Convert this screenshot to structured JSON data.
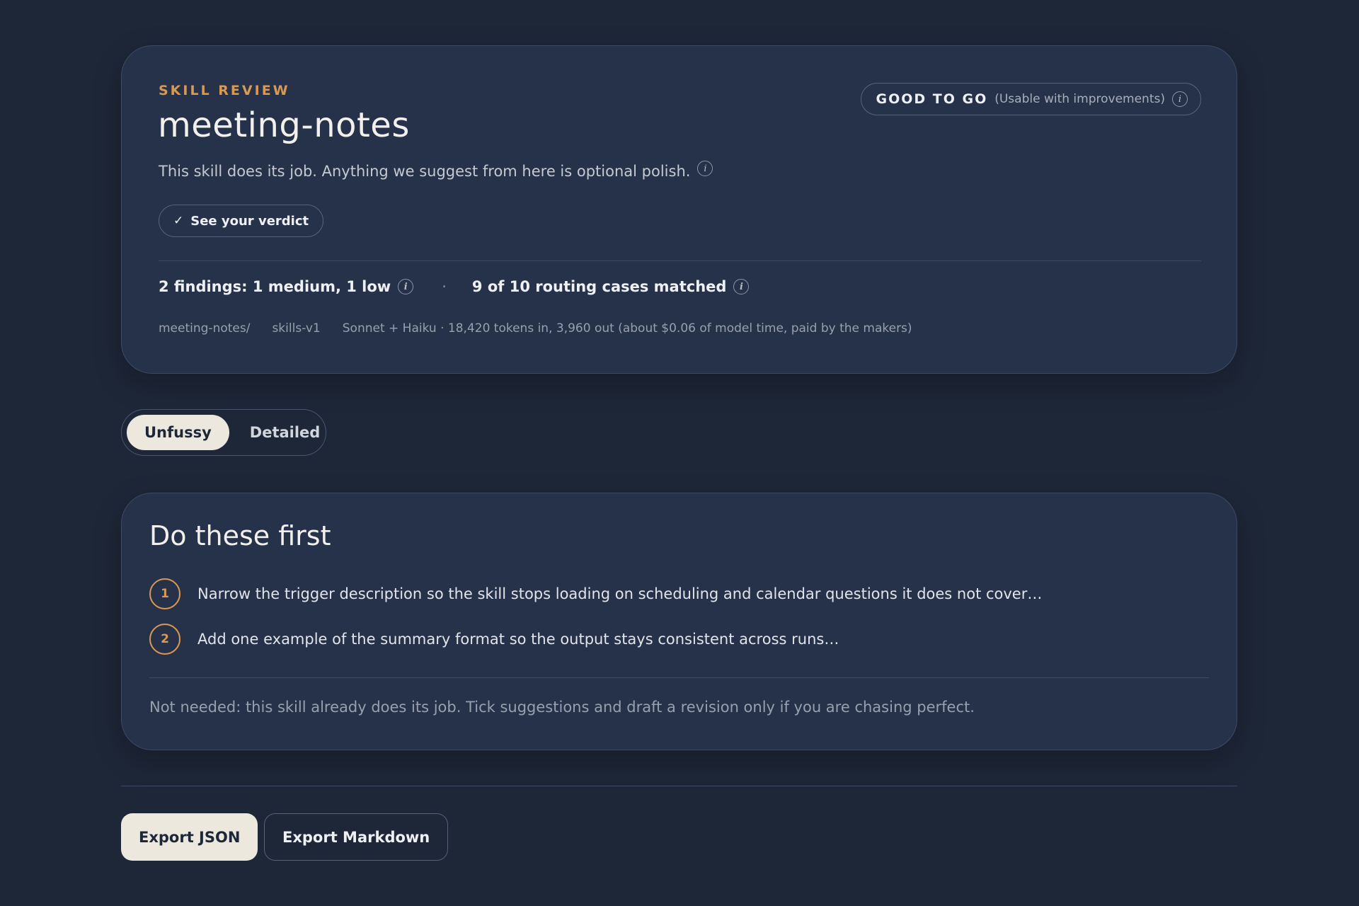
{
  "header": {
    "eyebrow": "SKILL REVIEW",
    "title": "meeting-notes",
    "subtitle": "This skill does its job. Anything we suggest from here is optional polish.",
    "status_main": "GOOD TO GO",
    "status_sub": "(Usable with improvements)",
    "verdict_label": "See your verdict",
    "findings": "2 findings: 1 medium, 1 low",
    "separator": "·",
    "routing": "9 of 10 routing cases matched",
    "meta": [
      "meeting-notes/",
      "skills-v1",
      "Sonnet + Haiku · 18,420 tokens in, 3,960 out (about $0.06 of model time, paid by the makers)"
    ]
  },
  "view_toggle": {
    "options": [
      "Unfussy",
      "Detailed"
    ],
    "selected": "Unfussy"
  },
  "first": {
    "title": "Do these first",
    "items": [
      {
        "num": "1",
        "text": "Narrow the trigger description so the skill stops loading on scheduling and calendar questions it does not cover…"
      },
      {
        "num": "2",
        "text": "Add one example of the summary format so the output stays consistent across runs…"
      }
    ],
    "note": "Not needed: this skill already does its job. Tick suggestions and draft a revision only if you are chasing perfect."
  },
  "actions": {
    "export_json": "Export JSON",
    "export_markdown": "Export Markdown"
  },
  "icons": {
    "info": "info-icon",
    "check": "check-icon"
  },
  "colors": {
    "background": "#1e2738",
    "card": "#26324a",
    "accent": "#d99a4e",
    "cream": "#ece8de"
  }
}
